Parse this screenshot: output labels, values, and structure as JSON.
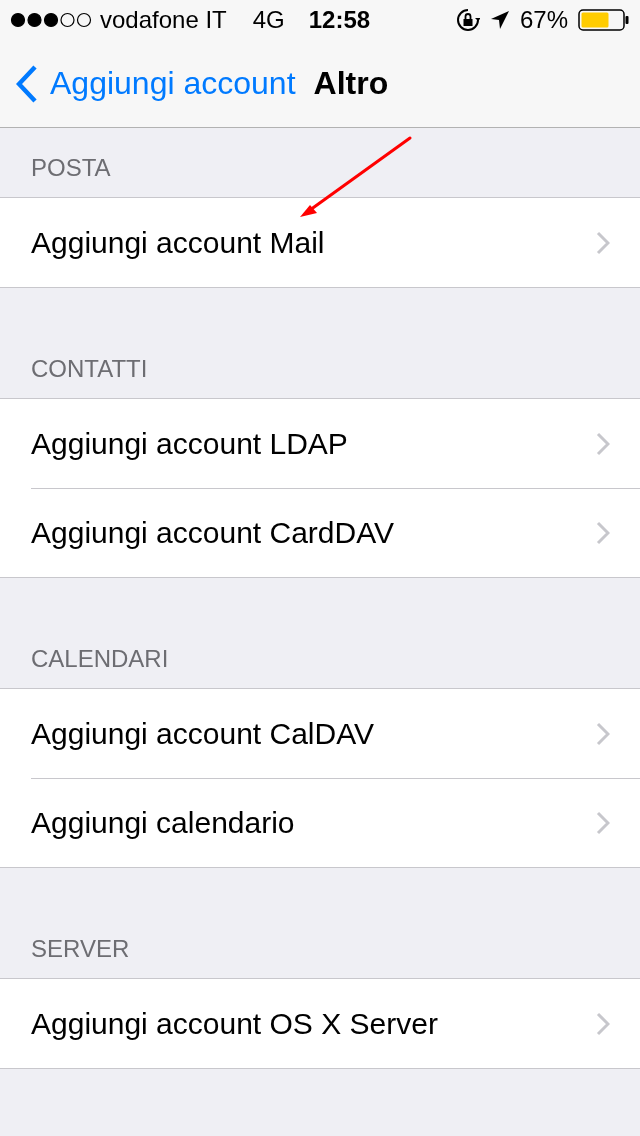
{
  "status_bar": {
    "carrier": "vodafone IT",
    "network": "4G",
    "time": "12:58",
    "battery": "67%"
  },
  "nav": {
    "back": "Aggiungi account",
    "title": "Altro"
  },
  "sections": [
    {
      "header": "POSTA",
      "items": [
        "Aggiungi account Mail"
      ]
    },
    {
      "header": "CONTATTI",
      "items": [
        "Aggiungi account LDAP",
        "Aggiungi account CardDAV"
      ]
    },
    {
      "header": "CALENDARI",
      "items": [
        "Aggiungi account CalDAV",
        "Aggiungi calendario"
      ]
    },
    {
      "header": "SERVER",
      "items": [
        "Aggiungi account OS X Server"
      ]
    }
  ]
}
